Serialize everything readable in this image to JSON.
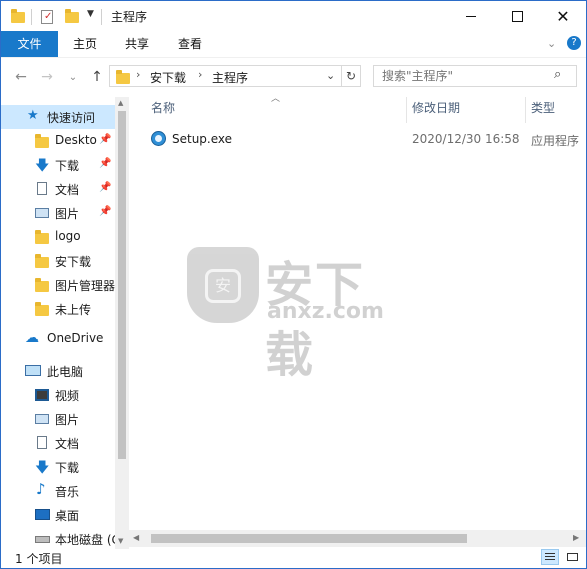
{
  "window": {
    "title": "主程序",
    "ribbon_tabs": [
      "文件",
      "主页",
      "共享",
      "查看"
    ]
  },
  "address_bar": {
    "crumbs": [
      "安下载",
      "主程序"
    ]
  },
  "search": {
    "placeholder": "搜索\"主程序\""
  },
  "nav": {
    "quick_access": "快速访问",
    "items": [
      {
        "label": "Deskto",
        "icon": "folder-icon",
        "pinned": true
      },
      {
        "label": "下载",
        "icon": "download-icon",
        "pinned": true
      },
      {
        "label": "文档",
        "icon": "document-icon",
        "pinned": true
      },
      {
        "label": "图片",
        "icon": "picture-icon",
        "pinned": true
      },
      {
        "label": "logo",
        "icon": "folder-icon",
        "pinned": false
      },
      {
        "label": "安下载",
        "icon": "folder-icon",
        "pinned": false
      },
      {
        "label": "图片管理器",
        "icon": "folder-icon",
        "pinned": false
      },
      {
        "label": "未上传",
        "icon": "folder-icon",
        "pinned": false
      }
    ],
    "onedrive": "OneDrive",
    "this_pc": "此电脑",
    "pc_items": [
      {
        "label": "视频",
        "icon": "video-icon"
      },
      {
        "label": "图片",
        "icon": "picture-icon"
      },
      {
        "label": "文档",
        "icon": "document-icon"
      },
      {
        "label": "下载",
        "icon": "download-icon"
      },
      {
        "label": "音乐",
        "icon": "music-icon"
      },
      {
        "label": "桌面",
        "icon": "desktop-icon"
      },
      {
        "label": "本地磁盘 (C",
        "icon": "drive-icon"
      }
    ]
  },
  "columns": {
    "name": "名称",
    "modified": "修改日期",
    "type": "类型"
  },
  "files": [
    {
      "name": "Setup.exe",
      "modified": "2020/12/30 16:58",
      "type": "应用程序"
    }
  ],
  "status": {
    "count": "1 个项目"
  },
  "watermark": {
    "brand": "安下载",
    "domain": "anxz.com",
    "shield_glyph": "安"
  },
  "colors": {
    "accent": "#1979ca",
    "selected": "#cce8ff",
    "folder": "#f5c842"
  }
}
